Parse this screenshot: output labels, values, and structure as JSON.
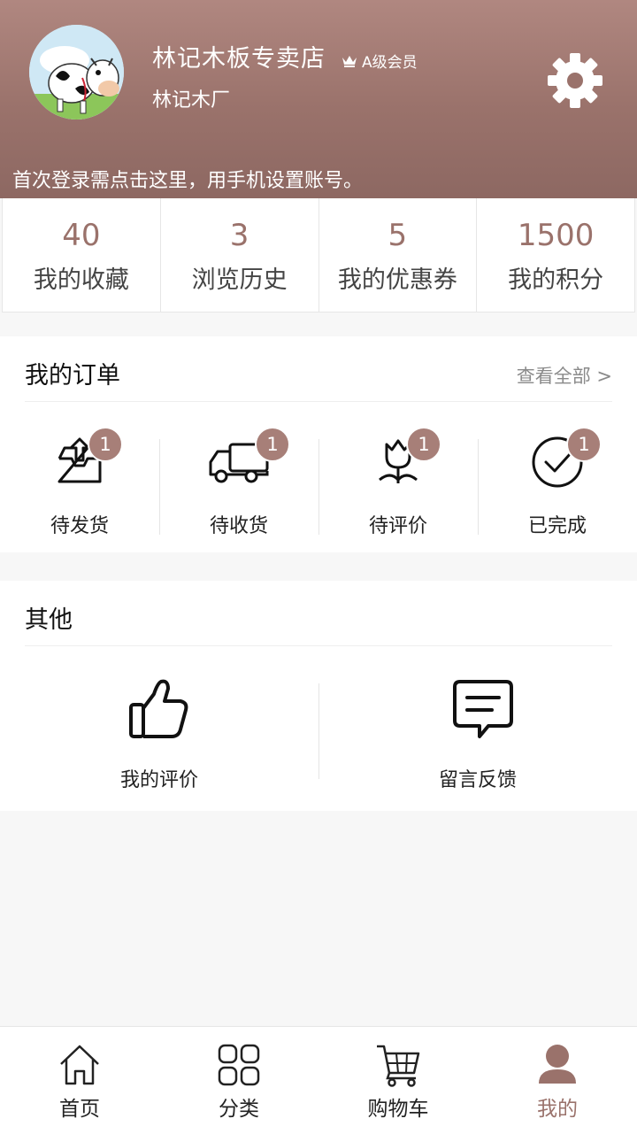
{
  "header": {
    "shop_name": "林记木板专卖店",
    "member_level": "A级会员",
    "sub_name": "林记木厂",
    "login_tip": "首次登录需点击这里，用手机设置账号。"
  },
  "stats": [
    {
      "value": "40",
      "label": "我的收藏"
    },
    {
      "value": "3",
      "label": "浏览历史"
    },
    {
      "value": "5",
      "label": "我的优惠券"
    },
    {
      "value": "1500",
      "label": "我的积分"
    }
  ],
  "orders": {
    "title": "我的订单",
    "view_all": "查看全部 >",
    "items": [
      {
        "label": "待发货",
        "badge": "1",
        "icon": "outbox-icon"
      },
      {
        "label": "待收货",
        "badge": "1",
        "icon": "truck-icon"
      },
      {
        "label": "待评价",
        "badge": "1",
        "icon": "flower-icon"
      },
      {
        "label": "已完成",
        "badge": "1",
        "icon": "check-circle-icon"
      }
    ]
  },
  "other": {
    "title": "其他",
    "items": [
      {
        "label": "我的评价",
        "icon": "thumbs-up-icon"
      },
      {
        "label": "留言反馈",
        "icon": "message-icon"
      }
    ]
  },
  "tabbar": {
    "items": [
      {
        "label": "首页",
        "icon": "home-icon"
      },
      {
        "label": "分类",
        "icon": "grid-icon"
      },
      {
        "label": "购物车",
        "icon": "cart-icon"
      },
      {
        "label": "我的",
        "icon": "user-icon"
      }
    ],
    "active_index": 3
  },
  "colors": {
    "accent": "#9a726b",
    "badge": "#a77f78"
  }
}
